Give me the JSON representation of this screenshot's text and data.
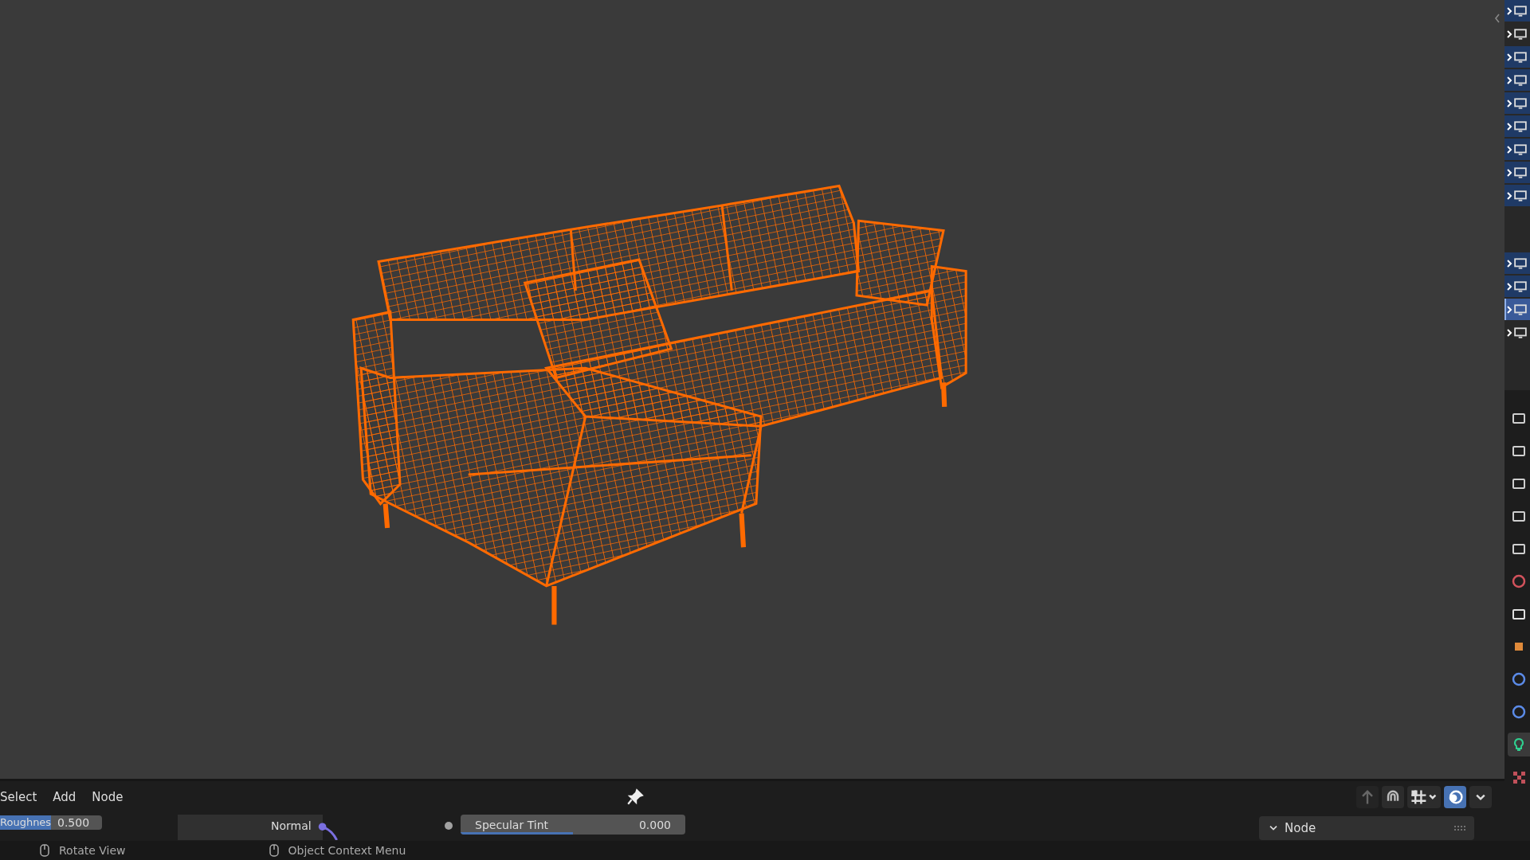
{
  "outliner": {
    "groups": [
      {
        "rows": [
          {
            "selected": true,
            "active": false
          },
          {
            "selected": false,
            "active": false
          },
          {
            "selected": true,
            "active": false
          },
          {
            "selected": true,
            "active": false
          },
          {
            "selected": true,
            "active": false
          },
          {
            "selected": true,
            "active": false
          },
          {
            "selected": true,
            "active": false
          },
          {
            "selected": true,
            "active": false
          },
          {
            "selected": true,
            "active": false
          }
        ]
      },
      {
        "rows": [
          {
            "selected": true,
            "active": false
          },
          {
            "selected": true,
            "active": false
          },
          {
            "selected": true,
            "active": true
          },
          {
            "selected": false,
            "active": false
          }
        ]
      }
    ]
  },
  "properties_tabs": [
    {
      "kind": "tool",
      "selected": false
    },
    {
      "kind": "render",
      "selected": false
    },
    {
      "kind": "output",
      "selected": false
    },
    {
      "kind": "view-layer",
      "selected": false
    },
    {
      "kind": "scene",
      "selected": false
    },
    {
      "kind": "world",
      "selected": false
    },
    {
      "kind": "collection",
      "selected": false
    },
    {
      "kind": "object",
      "selected": false
    },
    {
      "kind": "physics",
      "selected": false
    },
    {
      "kind": "constraints",
      "selected": false
    },
    {
      "kind": "data",
      "selected": true
    },
    {
      "kind": "texture",
      "selected": false
    }
  ],
  "node_editor": {
    "menu": [
      "Select",
      "Add",
      "Node"
    ],
    "overlays": {
      "on": true
    },
    "roughness": {
      "label": "Roughnes",
      "value": "0.500",
      "level": 0.5
    },
    "normal_socket": {
      "label": "Normal"
    },
    "specular_tint": {
      "label": "Specular Tint",
      "value": "0.000",
      "level": 0.5
    },
    "sidebar_panel": {
      "title": "Node",
      "expanded": true
    }
  },
  "status_bar": [
    {
      "kind": "left",
      "label": "Rotate View"
    },
    {
      "kind": "right",
      "label": "Object Context Menu"
    }
  ]
}
